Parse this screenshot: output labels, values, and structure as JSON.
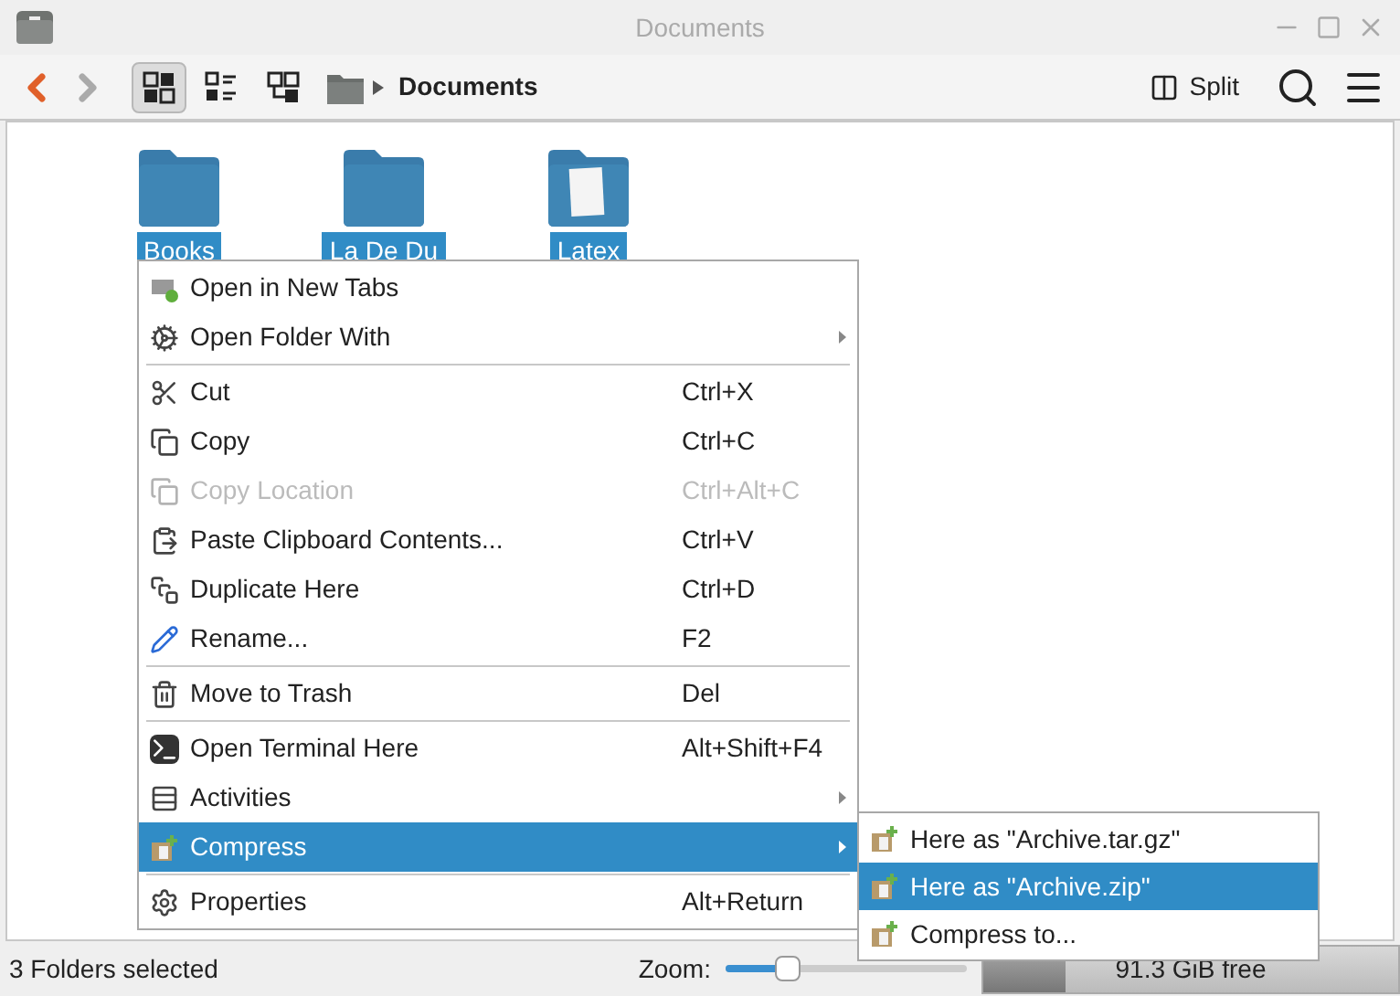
{
  "window": {
    "title": "Documents"
  },
  "toolbar": {
    "view_modes": [
      {
        "selected": true
      },
      {
        "selected": false
      },
      {
        "selected": false
      }
    ],
    "breadcrumb": "Documents",
    "split_label": "Split"
  },
  "files": [
    {
      "name": "Books",
      "kind": "folder",
      "selected": true
    },
    {
      "name": "La De Du",
      "kind": "folder",
      "selected": true
    },
    {
      "name": "Latex",
      "kind": "document-folder",
      "selected": true
    }
  ],
  "context_menu": [
    {
      "kind": "item",
      "label": "Open in New Tabs",
      "disabled": false,
      "selected": false,
      "submenu": false
    },
    {
      "kind": "item",
      "label": "Open Folder With",
      "disabled": false,
      "selected": false,
      "submenu": true
    },
    {
      "kind": "separator"
    },
    {
      "kind": "item",
      "label": "Cut",
      "shortcut": "Ctrl+X",
      "disabled": false,
      "selected": false,
      "submenu": false
    },
    {
      "kind": "item",
      "label": "Copy",
      "shortcut": "Ctrl+C",
      "disabled": false,
      "selected": false,
      "submenu": false
    },
    {
      "kind": "item",
      "label": "Copy Location",
      "shortcut": "Ctrl+Alt+C",
      "disabled": true,
      "selected": false,
      "submenu": false
    },
    {
      "kind": "item",
      "label": "Paste Clipboard Contents...",
      "shortcut": "Ctrl+V",
      "disabled": false,
      "selected": false,
      "submenu": false
    },
    {
      "kind": "item",
      "label": "Duplicate Here",
      "shortcut": "Ctrl+D",
      "disabled": false,
      "selected": false,
      "submenu": false
    },
    {
      "kind": "item",
      "label": "Rename...",
      "shortcut": "F2",
      "disabled": false,
      "selected": false,
      "submenu": false
    },
    {
      "kind": "separator"
    },
    {
      "kind": "item",
      "label": "Move to Trash",
      "shortcut": "Del",
      "disabled": false,
      "selected": false,
      "submenu": false
    },
    {
      "kind": "separator"
    },
    {
      "kind": "item",
      "label": "Open Terminal Here",
      "shortcut": "Alt+Shift+F4",
      "disabled": false,
      "selected": false,
      "submenu": false
    },
    {
      "kind": "item",
      "label": "Activities",
      "disabled": false,
      "selected": false,
      "submenu": true
    },
    {
      "kind": "item",
      "label": "Compress",
      "disabled": false,
      "selected": true,
      "submenu": true
    },
    {
      "kind": "separator"
    },
    {
      "kind": "item",
      "label": "Properties",
      "shortcut": "Alt+Return",
      "disabled": false,
      "selected": false,
      "submenu": false
    }
  ],
  "submenu": [
    {
      "label": "Here as \"Archive.tar.gz\"",
      "selected": false
    },
    {
      "label": "Here as \"Archive.zip\"",
      "selected": true
    },
    {
      "label": "Compress to...",
      "selected": false
    }
  ],
  "status_bar": {
    "text": "3 Folders selected",
    "zoom_label": "Zoom:",
    "zoom": {
      "level": 0.22
    },
    "free_space": {
      "text": "91.3 GiB free",
      "level": 0.2
    }
  }
}
